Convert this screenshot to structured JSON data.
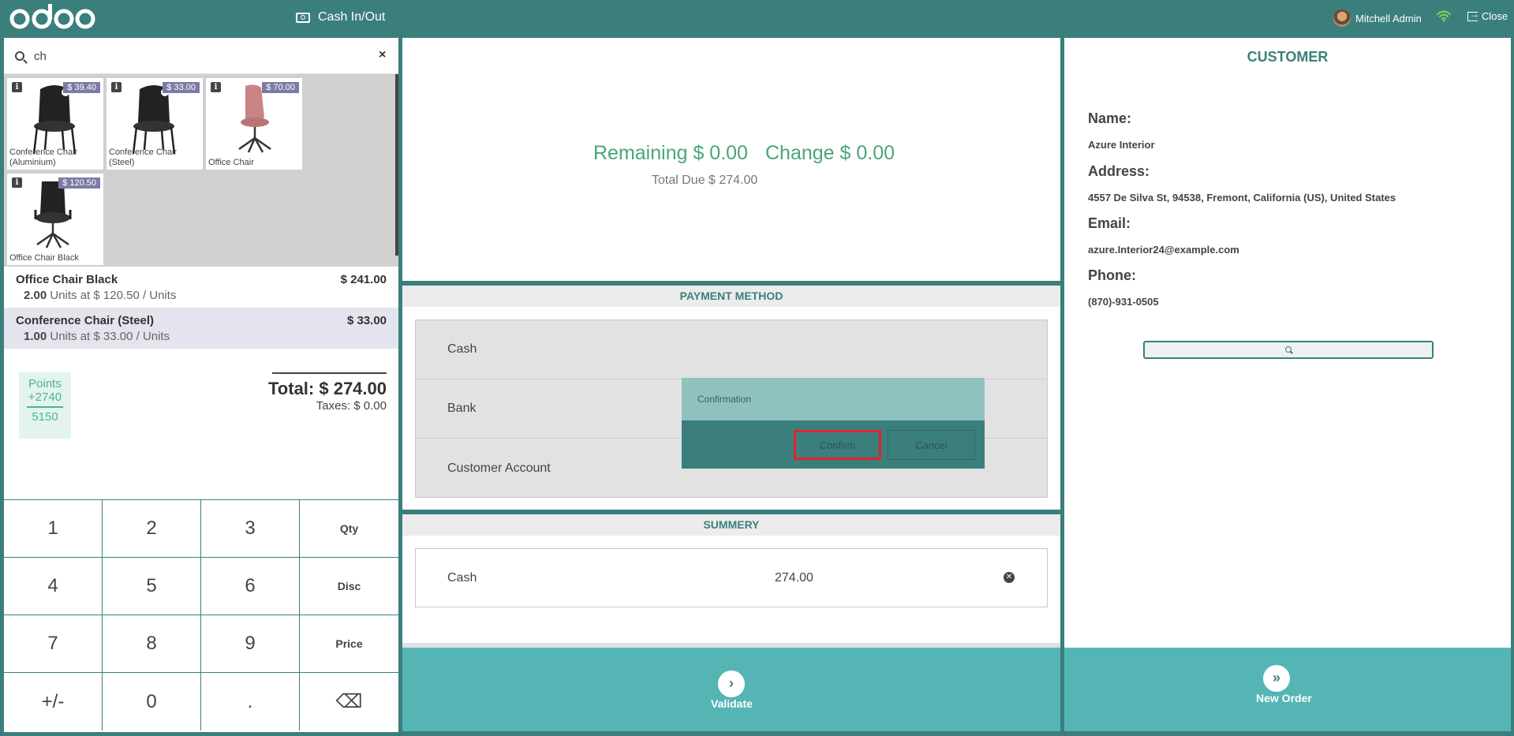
{
  "header": {
    "cash_in_out": "Cash In/Out",
    "user_name": "Mitchell Admin",
    "close_label": "Close"
  },
  "search": {
    "value": "ch",
    "clear": "×"
  },
  "products": [
    {
      "name": "Conference Chair (Aluminium)",
      "price": "$ 39.40"
    },
    {
      "name": "Conference Chair (Steel)",
      "price": "$ 33.00"
    },
    {
      "name": "Office Chair",
      "price": "$ 70.00"
    },
    {
      "name": "Office Chair Black",
      "price": "$ 120.50"
    }
  ],
  "orderlines": [
    {
      "name": "Office Chair Black",
      "price": "$ 241.00",
      "qty": "2.00",
      "unit_text": "Units at $ 120.50 / Units"
    },
    {
      "name": "Conference Chair (Steel)",
      "price": "$ 33.00",
      "qty": "1.00",
      "unit_text": "Units at $ 33.00 / Units"
    }
  ],
  "points": {
    "label": "Points",
    "won": "+2740",
    "total": "5150"
  },
  "totals": {
    "total": "Total: $ 274.00",
    "taxes": "Taxes: $ 0.00"
  },
  "numpad": [
    "1",
    "2",
    "3",
    "Qty",
    "4",
    "5",
    "6",
    "Disc",
    "7",
    "8",
    "9",
    "Price",
    "+/-",
    "0",
    ".",
    "⌫"
  ],
  "payment_status": {
    "remaining": "Remaining $ 0.00",
    "change": "Change $ 0.00",
    "total_due": "Total Due  $ 274.00"
  },
  "payment_methods": {
    "title": "PAYMENT METHOD",
    "items": [
      "Cash",
      "Bank",
      "Customer Account"
    ]
  },
  "summary": {
    "title": "SUMMERY",
    "line": {
      "method": "Cash",
      "amount": "274.00"
    }
  },
  "validate_label": "Validate",
  "customer": {
    "title": "CUSTOMER",
    "name_label": "Name:",
    "name": "Azure Interior",
    "address_label": "Address:",
    "address": "4557 De Silva St, 94538, Fremont, California (US), United States",
    "email_label": "Email:",
    "email": "azure.Interior24@example.com",
    "phone_label": "Phone:",
    "phone": "(870)-931-0505"
  },
  "new_order_label": "New Order",
  "popup": {
    "title": "Confirmation",
    "confirm": "Confirm",
    "cancel": "Cancel"
  },
  "colors": {
    "brand": "#3b7f7c",
    "accent": "#55b5b5",
    "green_text": "#4aa57a",
    "price_tag": "#7b7ba6",
    "highlight_border": "#e0242b"
  }
}
